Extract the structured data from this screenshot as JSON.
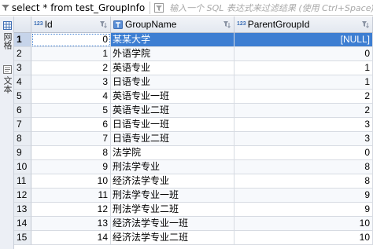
{
  "filter": {
    "sql": "select * from test_GroupInfo",
    "placeholder": "输入一个 SQL 表达式来过滤结果 (使用 Ctrl+Space)"
  },
  "sidebar": {
    "tabs": [
      {
        "label": "网格",
        "icon": "grid-icon"
      },
      {
        "label": "文本",
        "icon": "text-icon"
      }
    ]
  },
  "grid": {
    "columns": [
      {
        "label": "Id",
        "type_tag": "123",
        "icon": "numeric-icon"
      },
      {
        "label": "GroupName",
        "type_tag": "",
        "icon": "text-column-icon"
      },
      {
        "label": "ParentGroupId",
        "type_tag": "123",
        "icon": "numeric-icon"
      }
    ],
    "rows": [
      {
        "num": "1",
        "id": "0",
        "name": "某某大学",
        "pid": "[NULL]"
      },
      {
        "num": "2",
        "id": "1",
        "name": "外语学院",
        "pid": "0"
      },
      {
        "num": "3",
        "id": "2",
        "name": "英语专业",
        "pid": "1"
      },
      {
        "num": "4",
        "id": "3",
        "name": "日语专业",
        "pid": "1"
      },
      {
        "num": "5",
        "id": "4",
        "name": "英语专业一班",
        "pid": "2"
      },
      {
        "num": "6",
        "id": "5",
        "name": "英语专业二班",
        "pid": "2"
      },
      {
        "num": "7",
        "id": "6",
        "name": "日语专业一班",
        "pid": "3"
      },
      {
        "num": "8",
        "id": "7",
        "name": "日语专业二班",
        "pid": "3"
      },
      {
        "num": "9",
        "id": "8",
        "name": "法学院",
        "pid": "0"
      },
      {
        "num": "10",
        "id": "9",
        "name": "刑法学专业",
        "pid": "8"
      },
      {
        "num": "11",
        "id": "10",
        "name": "经济法学专业",
        "pid": "8"
      },
      {
        "num": "12",
        "id": "11",
        "name": "刑法学专业一班",
        "pid": "9"
      },
      {
        "num": "13",
        "id": "12",
        "name": "刑法学专业二班",
        "pid": "9"
      },
      {
        "num": "14",
        "id": "13",
        "name": "经济法学专业一班",
        "pid": "10"
      },
      {
        "num": "15",
        "id": "14",
        "name": "经济法学专业二班",
        "pid": "10"
      }
    ],
    "selected_row": 0
  }
}
